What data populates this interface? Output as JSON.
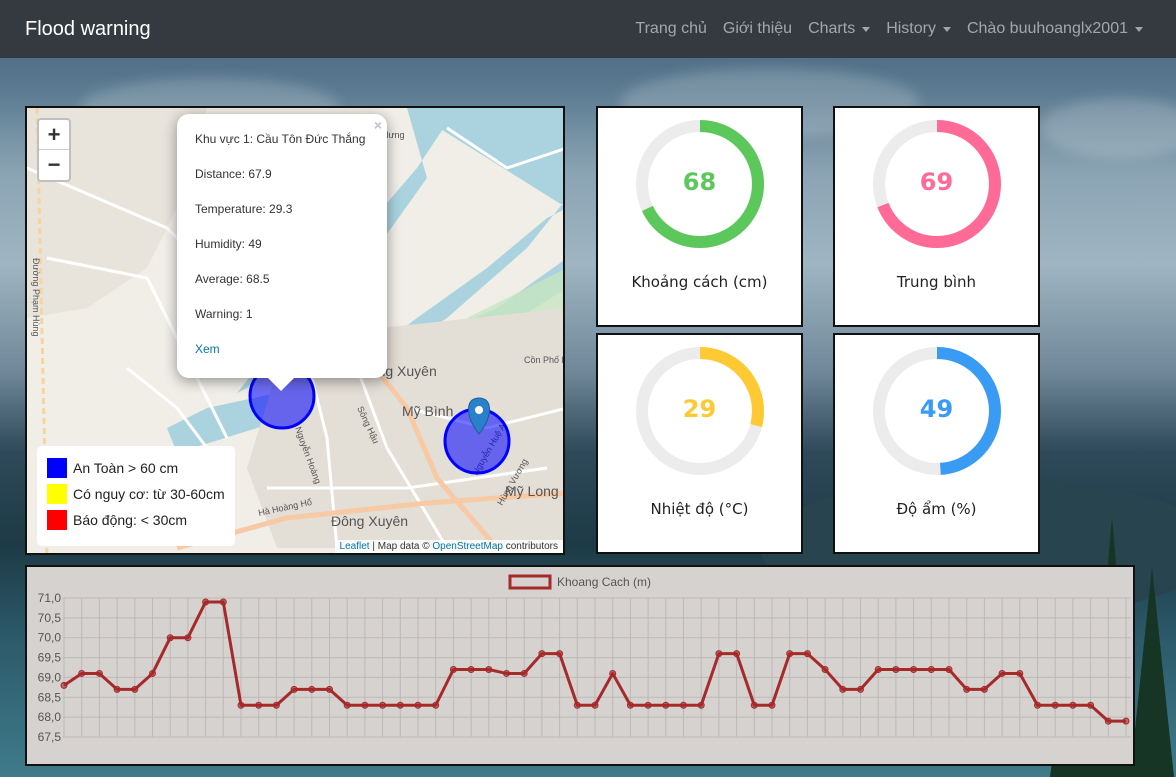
{
  "navbar": {
    "brand": "Flood warning",
    "items": [
      {
        "label": "Trang chủ",
        "dropdown": false
      },
      {
        "label": "Giới thiệu",
        "dropdown": false
      },
      {
        "label": "Charts",
        "dropdown": true
      },
      {
        "label": "History",
        "dropdown": true
      },
      {
        "label": "Chào buuhoanglx2001",
        "dropdown": true
      }
    ]
  },
  "map": {
    "zoom_in": "+",
    "zoom_out": "−",
    "place_labels": [
      "Hưng",
      "Long Xuyên",
      "Mỹ Bình",
      "Mỹ Long",
      "Đông Xuyên",
      "Cồn Phố Ba",
      "Đường Phạm Hùng",
      "Nguyễn Hoàng",
      "Hà Hoàng Hổ",
      "Nguyễn Huệ A",
      "Hùng Vương",
      "Sông Hậu"
    ],
    "popup": {
      "close": "×",
      "area": "Khu vực 1: Cầu Tôn Đức Thắng",
      "distance": "Distance: 67.9",
      "temperature": "Temperature: 29.3",
      "humidity": "Humidity: 49",
      "average": "Average: 68.5",
      "warning": "Warning: 1",
      "link": "Xem"
    },
    "legend": [
      {
        "label": "An Toàn > 60 cm",
        "color": "#0000ff"
      },
      {
        "label": "Có nguy cơ: từ 30-60cm",
        "color": "#ffff00"
      },
      {
        "label": "Báo động: < 30cm",
        "color": "#ff0000"
      }
    ],
    "attribution": {
      "leaflet": "Leaflet",
      "sep": " | Map data © ",
      "osm": "OpenStreetMap",
      "tail": " contributors"
    },
    "marker_color": "#0000ff"
  },
  "gauges": [
    {
      "value": "68",
      "label": "Khoảng cách (cm)",
      "percent": 68,
      "color": "#5cc85c"
    },
    {
      "value": "69",
      "label": "Trung bình",
      "percent": 69,
      "color": "#ff6a96"
    },
    {
      "value": "29",
      "label": "Nhiệt độ (°C)",
      "percent": 29,
      "color": "#ffc933"
    },
    {
      "value": "49",
      "label": "Độ ẩm (%)",
      "percent": 49,
      "color": "#3a9bf5"
    }
  ],
  "chart_data": {
    "type": "line",
    "title": "",
    "legend": "Khoang Cach (m)",
    "legend_position": "top-center",
    "grid": true,
    "ylim": [
      67.5,
      71.0
    ],
    "y_ticks": [
      "71,0",
      "70,5",
      "70,0",
      "69,5",
      "69,0",
      "68,5",
      "68,0",
      "67,5"
    ],
    "series": [
      {
        "name": "Khoang Cach (m)",
        "color": "#a52a2a",
        "values": [
          68.8,
          69.1,
          69.1,
          68.7,
          68.7,
          69.1,
          70.0,
          70.0,
          70.9,
          70.9,
          68.3,
          68.3,
          68.3,
          68.7,
          68.7,
          68.7,
          68.3,
          68.3,
          68.3,
          68.3,
          68.3,
          68.3,
          69.2,
          69.2,
          69.2,
          69.1,
          69.1,
          69.6,
          69.6,
          68.3,
          68.3,
          69.1,
          68.3,
          68.3,
          68.3,
          68.3,
          68.3,
          69.6,
          69.6,
          68.3,
          68.3,
          69.6,
          69.6,
          69.2,
          68.7,
          68.7,
          69.2,
          69.2,
          69.2,
          69.2,
          69.2,
          68.7,
          68.7,
          69.1,
          69.1,
          68.3,
          68.3,
          68.3,
          68.3,
          67.9,
          67.9
        ]
      }
    ]
  }
}
